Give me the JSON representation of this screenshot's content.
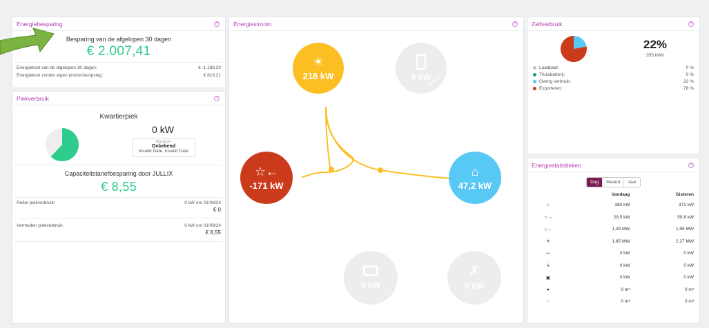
{
  "energiebesparing": {
    "title": "Energiebesparing",
    "heading": "Besparing van de afgelopen 30 dagen",
    "amount": "€ 2.007,41",
    "rows": [
      {
        "label": "Energiekost van de afgelopen 30 dagen:",
        "value": "€ -1.188,20"
      },
      {
        "label": "Energiekost zonder eigen productie/opslag:",
        "value": "€ 819,21"
      }
    ]
  },
  "piekverbruik": {
    "title": "Piekverbruik",
    "heading": "Kwartierpiek",
    "value": "0 kW",
    "max_label": "Maximum",
    "status": "Onbekend",
    "dates": "Invalid Date, Invalid Date",
    "pie_fraction": 0.62,
    "cap_heading": "Capaciteitstariefbesparing door JULLIX",
    "cap_amount": "€ 8,55",
    "reeel_label": "Reëel piekverbruik:",
    "reeel_value": "0 kW om 01/08/24",
    "reeel_amount": "€ 0",
    "vermeden_label": "Vermeden piekverbruik:",
    "vermeden_value": "0 kW om 01/08/24",
    "vermeden_amount": "€ 8,55"
  },
  "energiestroom": {
    "title": "Energiestroom",
    "solar": "218 kW",
    "battery": "0 kW",
    "battery_state": "Onbekend",
    "grid": "-171 kW",
    "home": "47,2 kW",
    "car": "0 kW",
    "plug": "0 kW",
    "colors": {
      "solar": "#fbbf24",
      "grid": "#cc3a1c",
      "home": "#58c8f4",
      "inactive": "#ededed"
    }
  },
  "zelfverbruik": {
    "title": "Zelfverbruik",
    "percent": "22%",
    "kwh": "355 kWh",
    "legend": [
      {
        "label": "Laadpaal:",
        "value": "0 %",
        "color": "#c2c2c2"
      },
      {
        "label": "Thuisbatterij:",
        "value": "0 %",
        "color": "#16a085"
      },
      {
        "label": "Overig verbruik:",
        "value": "22 %",
        "color": "#58c8f4"
      },
      {
        "label": "Exporteren:",
        "value": "78 %",
        "color": "#cc3a1c"
      }
    ]
  },
  "energiestatistieken": {
    "title": "Energiestatistieken",
    "tabs": [
      "Dag",
      "Maand",
      "Jaar"
    ],
    "active_tab": "Dag",
    "col_today": "Vandaag",
    "col_yesterday": "Gisteren",
    "rows": [
      {
        "icon": "home-icon",
        "today": "384 kW",
        "yesterday": "371 kW"
      },
      {
        "icon": "grid-import-icon",
        "today": "29,5 kW",
        "yesterday": "50,8 kW"
      },
      {
        "icon": "grid-export-icon",
        "today": "1,29 MW",
        "yesterday": "1,95 MW"
      },
      {
        "icon": "solar-icon",
        "today": "1,65 MW",
        "yesterday": "2,27 MW"
      },
      {
        "icon": "battery-charge-icon",
        "today": "0 kW",
        "yesterday": "0 kW"
      },
      {
        "icon": "battery-discharge-icon",
        "today": "0 kW",
        "yesterday": "0 kW"
      },
      {
        "icon": "car-icon",
        "today": "0 kW",
        "yesterday": "0 kW"
      },
      {
        "icon": "gas-icon",
        "today": "0 m³",
        "yesterday": "0 m³"
      },
      {
        "icon": "water-icon",
        "today": "0 m³",
        "yesterday": "0 m³"
      }
    ]
  }
}
